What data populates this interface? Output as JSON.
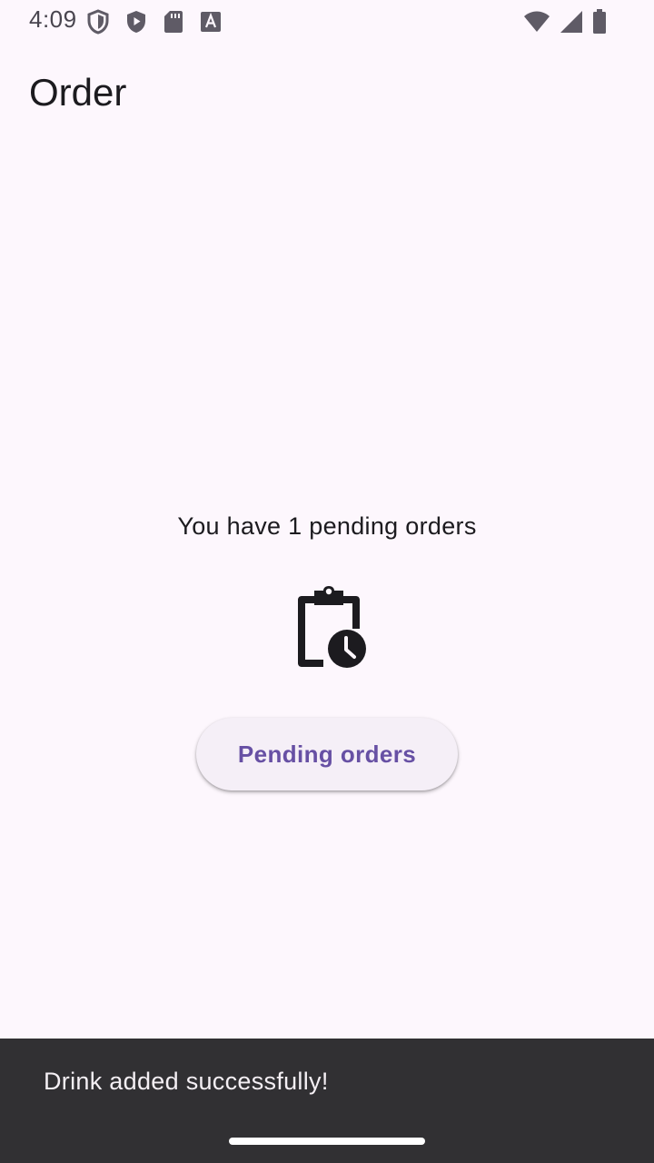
{
  "status_bar": {
    "time": "4:09",
    "left_icons": [
      "shield-outline-icon",
      "play-protect-icon",
      "sd-card-icon",
      "font-a-icon"
    ],
    "right_icons": [
      "wifi-icon",
      "cellular-signal-icon",
      "battery-icon"
    ]
  },
  "app_bar": {
    "title": "Order"
  },
  "main": {
    "pending_message": "You have 1 pending orders",
    "status_icon": "pending-actions-icon",
    "pending_button_label": "Pending orders"
  },
  "snackbar": {
    "message": "Drink added successfully!"
  },
  "colors": {
    "background": "#fdf7fd",
    "button_background": "#f5eff7",
    "button_text": "#6750a4",
    "snackbar_background": "#313033",
    "snackbar_text": "#f4eff4"
  }
}
